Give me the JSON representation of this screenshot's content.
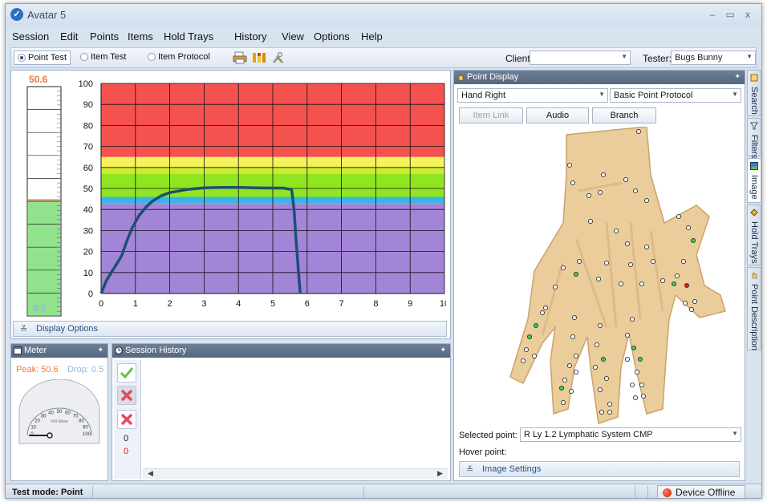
{
  "window": {
    "title": "Avatar 5",
    "min": "–",
    "max": "▭",
    "close": "x"
  },
  "menu": [
    "Session",
    "Edit",
    "Points",
    "Items",
    "Hold Trays",
    "History",
    "View",
    "Options",
    "Help"
  ],
  "toolbar": {
    "modes": [
      "Point Test",
      "Item Test",
      "Item Protocol"
    ],
    "selected_mode": "Point Test",
    "client_label": "Client:",
    "client_value": "",
    "tester_label": "Tester:",
    "tester_value": "Bugs Bunny"
  },
  "gauge_bar": {
    "peak_label": "50.6",
    "drop_label": "0.5",
    "fill_level": 0.506
  },
  "chart_data": {
    "type": "line",
    "xlim": [
      0,
      10
    ],
    "ylim": [
      0,
      100
    ],
    "x_ticks": [
      "0",
      "1",
      "2",
      "3",
      "4",
      "5",
      "6",
      "7",
      "8",
      "9",
      "10"
    ],
    "y_ticks": [
      "0",
      "10",
      "20",
      "30",
      "40",
      "50",
      "60",
      "70",
      "80",
      "90",
      "100"
    ],
    "grid": true,
    "bands": [
      {
        "from": 0,
        "to": 43,
        "color": "#a385d8"
      },
      {
        "from": 43,
        "to": 46,
        "color": "#39b5e5"
      },
      {
        "from": 46,
        "to": 57,
        "color": "#8fe620"
      },
      {
        "from": 57,
        "to": 60,
        "color": "#cdea33"
      },
      {
        "from": 60,
        "to": 65,
        "color": "#f6f25a"
      },
      {
        "from": 65,
        "to": 100,
        "color": "#f4524f"
      }
    ],
    "series": [
      {
        "color": "#1f4e74",
        "x": [
          0,
          0.15,
          0.3,
          0.45,
          0.6,
          0.75,
          0.9,
          1.1,
          1.3,
          1.5,
          1.75,
          2.0,
          2.5,
          3.0,
          3.5,
          4.0,
          4.5,
          5.0,
          5.3,
          5.55,
          5.62,
          5.68,
          5.75,
          5.8
        ],
        "y": [
          0,
          6,
          10,
          14,
          18,
          25,
          31,
          37,
          41,
          44,
          46.5,
          48,
          49.5,
          50.3,
          50.5,
          50.5,
          50.3,
          50.2,
          50.2,
          49.5,
          40,
          25,
          10,
          0
        ]
      }
    ]
  },
  "display_options_label": "Display Options",
  "meter": {
    "title": "Meter",
    "peak_text": "Peak: 50.6",
    "drop_text": "Drop: 0.5",
    "dial_caption": "Volt Meter",
    "dial_labels": [
      "0",
      "10",
      "20",
      "30",
      "40",
      "50",
      "60",
      "70",
      "80",
      "90",
      "100"
    ]
  },
  "session_history": {
    "title": "Session History",
    "count_ok": "0",
    "count_bad": "0"
  },
  "point_display": {
    "title": "Point Display",
    "location": "Hand Right",
    "protocol": "Basic Point Protocol",
    "buttons": {
      "item_link": "Item Link",
      "audio": "Audio",
      "branch": "Branch"
    },
    "selected_label": "Selected point:",
    "selected_value": "R Ly 1.2 Lymphatic System CMP",
    "hover_label": "Hover point:",
    "image_settings_label": "Image Settings"
  },
  "side_tabs": [
    "Search",
    "Filters",
    "Image",
    "Hold Trays",
    "Point Description"
  ],
  "status": {
    "mode_text": "Test mode: Point",
    "device_text": "Device Offline"
  },
  "colors": {
    "accent": "#2b4f86",
    "panel_header": "#5f7189",
    "gauge_fill": "#90e38c"
  }
}
